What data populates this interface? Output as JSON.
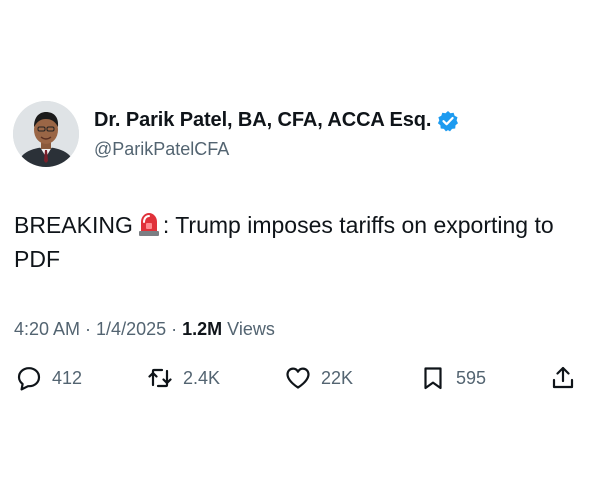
{
  "author": {
    "display_name": "Dr. Parik Patel, BA, CFA, ACCA Esq.",
    "handle": "@ParikPatelCFA",
    "verified": true
  },
  "tweet": {
    "text_before_emoji": "BREAKING",
    "emoji": "siren-emoji",
    "text_after_emoji": ": Trump imposes tariffs on exporting to PDF"
  },
  "meta": {
    "time": "4:20 AM",
    "separator": "·",
    "date": "1/4/2025",
    "views_count": "1.2M",
    "views_label": "Views"
  },
  "actions": {
    "replies": "412",
    "reposts": "2.4K",
    "likes": "22K",
    "bookmarks": "595"
  },
  "icons": {
    "reply": "reply-icon",
    "repost": "repost-icon",
    "like": "heart-icon",
    "bookmark": "bookmark-icon",
    "share": "share-icon",
    "verified": "verified-badge-icon"
  },
  "colors": {
    "text_primary": "#0f1419",
    "text_secondary": "#536471",
    "verified_blue": "#1d9bf0",
    "background": "#ffffff"
  }
}
